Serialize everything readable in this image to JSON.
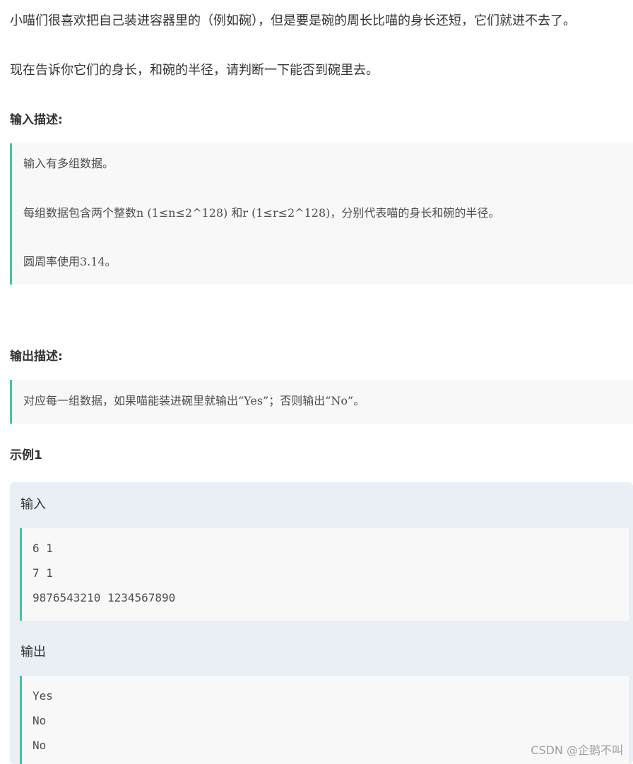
{
  "intro": {
    "line1": "小喵们很喜欢把自己装进容器里的（例如碗），但是要是碗的周长比喵的身长还短，它们就进不去了。",
    "line2": "现在告诉你它们的身长，和碗的半径，请判断一下能否到碗里去。"
  },
  "input_section": {
    "heading": "输入描述:",
    "lines": [
      "输入有多组数据。",
      "每组数据包含两个整数n (1≤n≤2^128) 和r (1≤r≤2^128)，分别代表喵的身长和碗的半径。",
      "圆周率使用3.14。"
    ]
  },
  "output_section": {
    "heading": "输出描述:",
    "lines": [
      "对应每一组数据，如果喵能装进碗里就输出“Yes”；否则输出“No”。"
    ]
  },
  "example": {
    "heading": "示例1",
    "input_label": "输入",
    "input_lines": [
      "6 1",
      "7 1",
      "9876543210 1234567890"
    ],
    "output_label": "输出",
    "output_lines": [
      "Yes",
      "No",
      "No"
    ]
  },
  "watermark": "CSDN @企鹅不叫",
  "colors": {
    "accent_border": "#42c5a0",
    "quote_bg": "#f8f8f8",
    "example_bg": "#eaeef5"
  }
}
